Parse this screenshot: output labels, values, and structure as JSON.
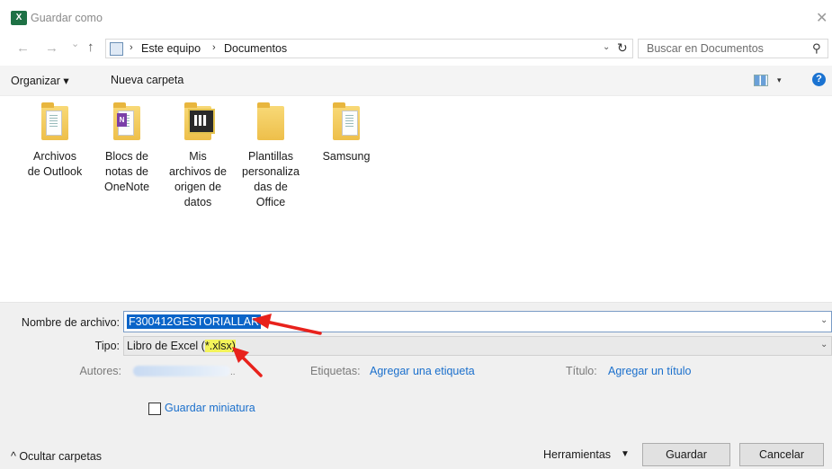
{
  "window": {
    "title": "Guardar como",
    "app_icon_letter": "X",
    "close_glyph": "✕"
  },
  "nav": {
    "back_glyph": "←",
    "forward_glyph": "→",
    "recent_glyph": "⌄",
    "up_glyph": "↑",
    "breadcrumb": [
      "Este equipo",
      "Documentos"
    ],
    "separator": "›",
    "dropdown_glyph": "⌄",
    "refresh_glyph": "↻",
    "search_placeholder": "Buscar en Documentos",
    "search_glyph": "⚲"
  },
  "toolbar": {
    "organize_label": "Organizar ▾",
    "new_folder_label": "Nueva carpeta",
    "view_drop_glyph": "▾",
    "help_glyph": "?"
  },
  "files": [
    {
      "name": "Archivos de Outlook",
      "lines": [
        "Archivos",
        "de Outlook"
      ],
      "icon": "outlook-folder-icon"
    },
    {
      "name": "Blocs de notas de OneNote",
      "lines": [
        "Blocs de",
        "notas de",
        "OneNote"
      ],
      "icon": "onenote-folder-icon"
    },
    {
      "name": "Mis archivos de origen de datos",
      "lines": [
        "Mis",
        "archivos de",
        "origen de",
        "datos"
      ],
      "icon": "data-source-folder-icon"
    },
    {
      "name": "Plantillas personalizadas de Office",
      "lines": [
        "Plantillas",
        "personaliza",
        "das de",
        "Office"
      ],
      "icon": "folder-icon"
    },
    {
      "name": "Samsung",
      "lines": [
        "Samsung"
      ],
      "icon": "document-folder-icon"
    }
  ],
  "form": {
    "filename_label": "Nombre de archivo:",
    "filename_value": "F300412GESTORIALLAR",
    "type_label": "Tipo:",
    "type_value_prefix": "Libro de Excel (",
    "type_value_highlight": "*.xlsx)",
    "authors_label": "Autores:",
    "tags_label": "Etiquetas:",
    "tags_link": "Agregar una etiqueta",
    "title_label": "Título:",
    "title_link": "Agregar un título",
    "thumbnail_label": "Guardar miniatura",
    "combo_arrow": "⌄",
    "ellipsis": ".."
  },
  "footer": {
    "hide_folders_label": "^  Ocultar carpetas",
    "tools_label": "Herramientas",
    "tools_drop": "▼",
    "save_label": "Guardar",
    "cancel_label": "Cancelar"
  },
  "colors": {
    "accent": "#0a64c8",
    "link": "#1a6fcc",
    "annotation_arrow": "#e8221c",
    "highlight": "#f3f35a"
  }
}
